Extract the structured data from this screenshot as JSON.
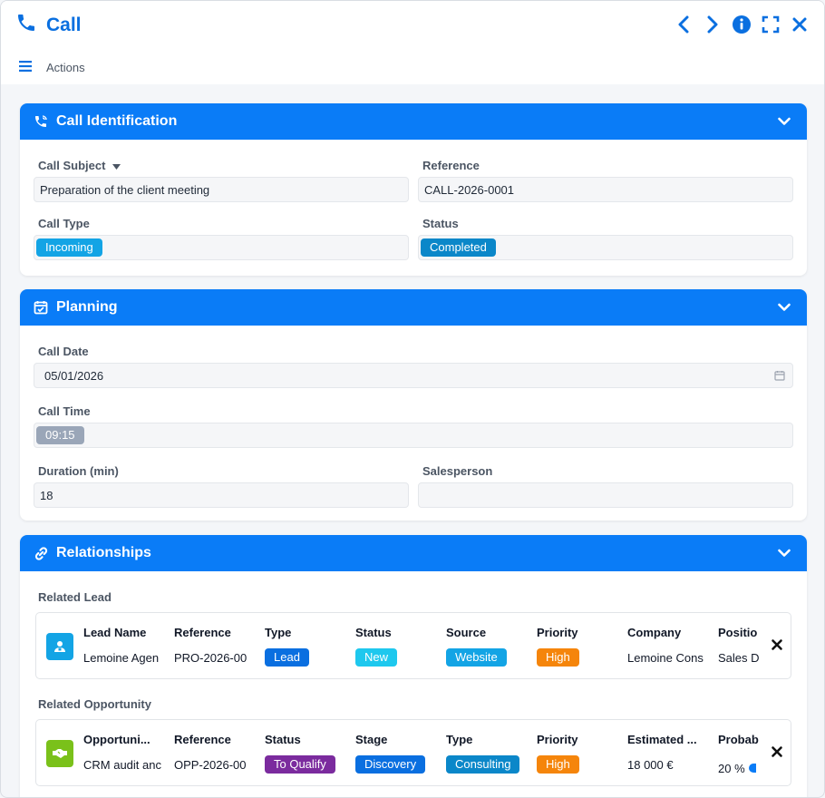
{
  "window": {
    "title": "Call",
    "actions_label": "Actions"
  },
  "colors": {
    "primary": "#0a7cf7",
    "title": "#0a6fe0"
  },
  "sections": {
    "identification": {
      "title": "Call Identification",
      "call_subject_label": "Call Subject",
      "call_subject_value": "Preparation of the client meeting",
      "reference_label": "Reference",
      "reference_value": "CALL-2026-0001",
      "call_type_label": "Call Type",
      "call_type_value": "Incoming",
      "status_label": "Status",
      "status_value": "Completed"
    },
    "planning": {
      "title": "Planning",
      "call_date_label": "Call Date",
      "call_date_value": "05/01/2026",
      "call_time_label": "Call Time",
      "call_time_value": "09:15",
      "duration_label": "Duration (min)",
      "duration_value": "18",
      "salesperson_label": "Salesperson",
      "salesperson_value": ""
    },
    "relationships": {
      "title": "Relationships",
      "lead": {
        "label": "Related Lead",
        "headers": [
          "Lead Name",
          "Reference",
          "Type",
          "Status",
          "Source",
          "Priority",
          "Company",
          "Positio"
        ],
        "values": [
          "Lemoine Agen",
          "PRO-2026-00",
          "Lead",
          "New",
          "Website",
          "High",
          "Lemoine Cons",
          "Sales D"
        ]
      },
      "opportunity": {
        "label": "Related Opportunity",
        "headers": [
          "Opportuni...",
          "Reference",
          "Status",
          "Stage",
          "Type",
          "Priority",
          "Estimated ...",
          "Probab"
        ],
        "values": [
          "CRM audit anc",
          "OPP-2026-00",
          "To Qualify",
          "Discovery",
          "Consulting",
          "High",
          "18 000 €",
          "20 %"
        ]
      }
    }
  }
}
